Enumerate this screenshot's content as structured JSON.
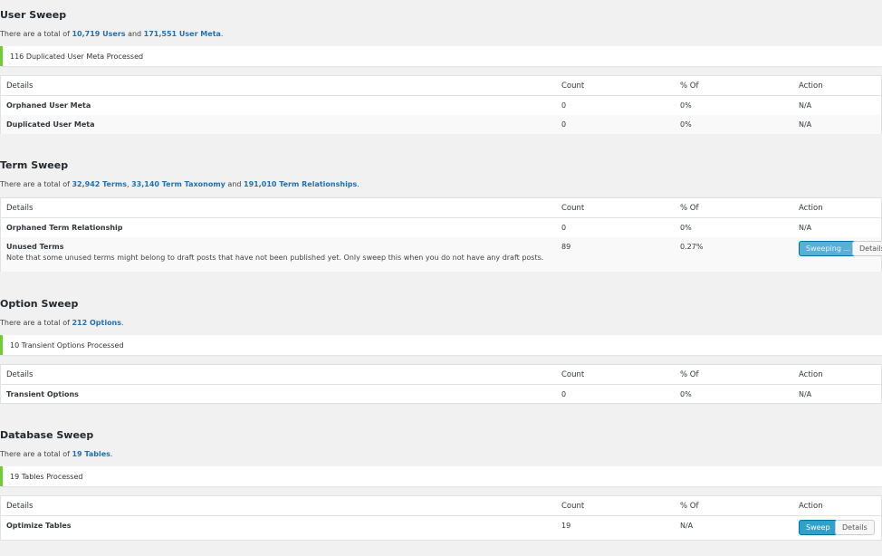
{
  "columns": {
    "details": "Details",
    "count": "Count",
    "percent": "% Of",
    "action": "Action"
  },
  "user": {
    "title": "User Sweep",
    "text_pre": "There are a total of ",
    "link1": "10,719 Users",
    "text_mid": " and ",
    "link2": "171,551 User Meta",
    "text_end": ".",
    "notice": "116 Duplicated User Meta Processed",
    "rows": [
      {
        "name": "Orphaned User Meta",
        "count": "0",
        "percent": "0%",
        "action": "N/A"
      },
      {
        "name": "Duplicated User Meta",
        "count": "0",
        "percent": "0%",
        "action": "N/A"
      }
    ]
  },
  "term": {
    "title": "Term Sweep",
    "text_pre": "There are a total of ",
    "link1": "32,942 Terms",
    "text_mid1": ", ",
    "link2": "33,140 Term Taxonomy",
    "text_mid2": " and ",
    "link3": "191,010 Term Relationships",
    "text_end": ".",
    "rows": [
      {
        "name": "Orphaned Term Relationship",
        "count": "0",
        "percent": "0%",
        "action": "N/A"
      },
      {
        "name": "Unused Terms",
        "count": "89",
        "percent": "0.27%",
        "note": "Note that some unused terms might belong to draft posts that have not been published yet. Only sweep this when you do not have any draft posts.",
        "button_primary": "Sweeping ...",
        "button_secondary": "Details"
      }
    ]
  },
  "option": {
    "title": "Option Sweep",
    "text_pre": "There are a total of ",
    "link1": "212 Options",
    "text_end": ".",
    "notice": "10 Transient Options Processed",
    "rows": [
      {
        "name": "Transient Options",
        "count": "0",
        "percent": "0%",
        "action": "N/A"
      }
    ]
  },
  "database": {
    "title": "Database Sweep",
    "text_pre": "There are a total of ",
    "link1": "19 Tables",
    "text_end": ".",
    "notice": "19 Tables Processed",
    "rows": [
      {
        "name": "Optimize Tables",
        "count": "19",
        "percent": "N/A",
        "button_primary": "Sweep",
        "button_secondary": "Details"
      }
    ]
  },
  "colors": {
    "notice_border": "#6bd130",
    "link": "#2271b1",
    "button_primary": "#2ea2cc"
  }
}
